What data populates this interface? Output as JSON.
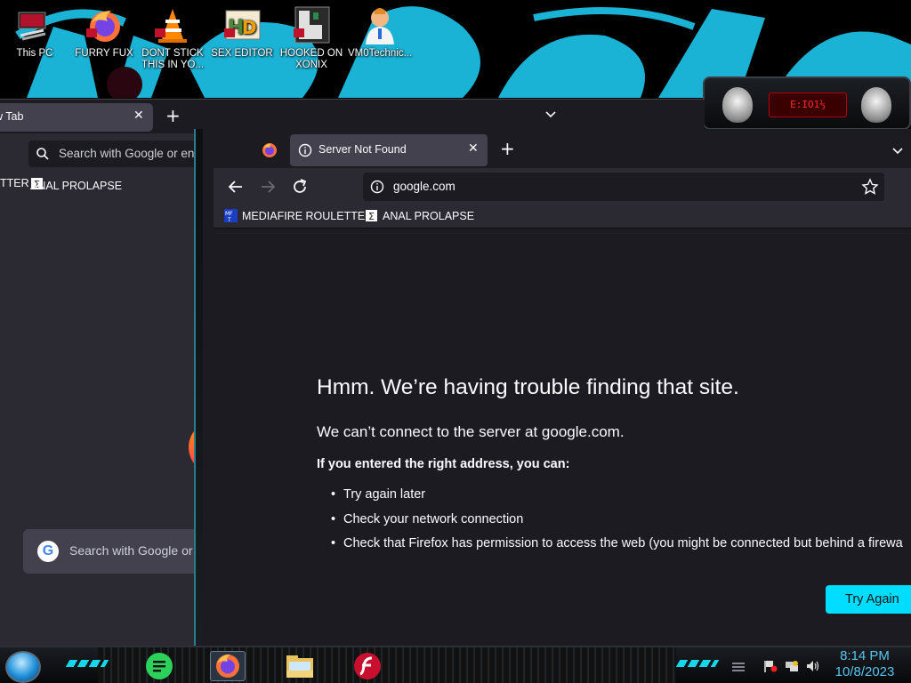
{
  "desktop": {
    "icons": [
      {
        "label": "This PC"
      },
      {
        "label": "FURRY FUX"
      },
      {
        "label": "DONT STICK\nTHIS IN YO..."
      },
      {
        "label": "SEX EDITOR"
      },
      {
        "label": "HOOKED ON\nXONIX"
      },
      {
        "label": "VM0Technic..."
      }
    ],
    "badge_text": "E:IO1⅓"
  },
  "back_window": {
    "tab_title": "w Tab",
    "search_placeholder": "Search with Google or en",
    "bookmarks": [
      "TTER",
      "ANAL PROLAPSE"
    ],
    "big_search_placeholder": "Search with Google or"
  },
  "front_window": {
    "tab_title": "Server Not Found",
    "url": "google.com",
    "bookmarks": [
      {
        "label": "MEDIAFIRE ROULETTER"
      },
      {
        "label": "ANAL PROLAPSE"
      }
    ],
    "error": {
      "title": "Hmm. We’re having trouble finding that site.",
      "subtitle": "We can’t connect to the server at google.com.",
      "hint": "If you entered the right address, you can:",
      "items": [
        "Try again later",
        "Check your network connection",
        "Check that Firefox has permission to access the web (you might be connected but behind a firewa"
      ],
      "button": "Try Again"
    }
  },
  "taskbar": {
    "clock_time": "8:14 PM",
    "clock_date": "10/8/2023"
  },
  "colors": {
    "accent_cyan": "#00ddff",
    "wallpaper_cyan": "#16b6d8",
    "page_bg": "#1c1b22",
    "toolbar_bg": "#2b2a33",
    "tab_bg": "#42414d"
  }
}
